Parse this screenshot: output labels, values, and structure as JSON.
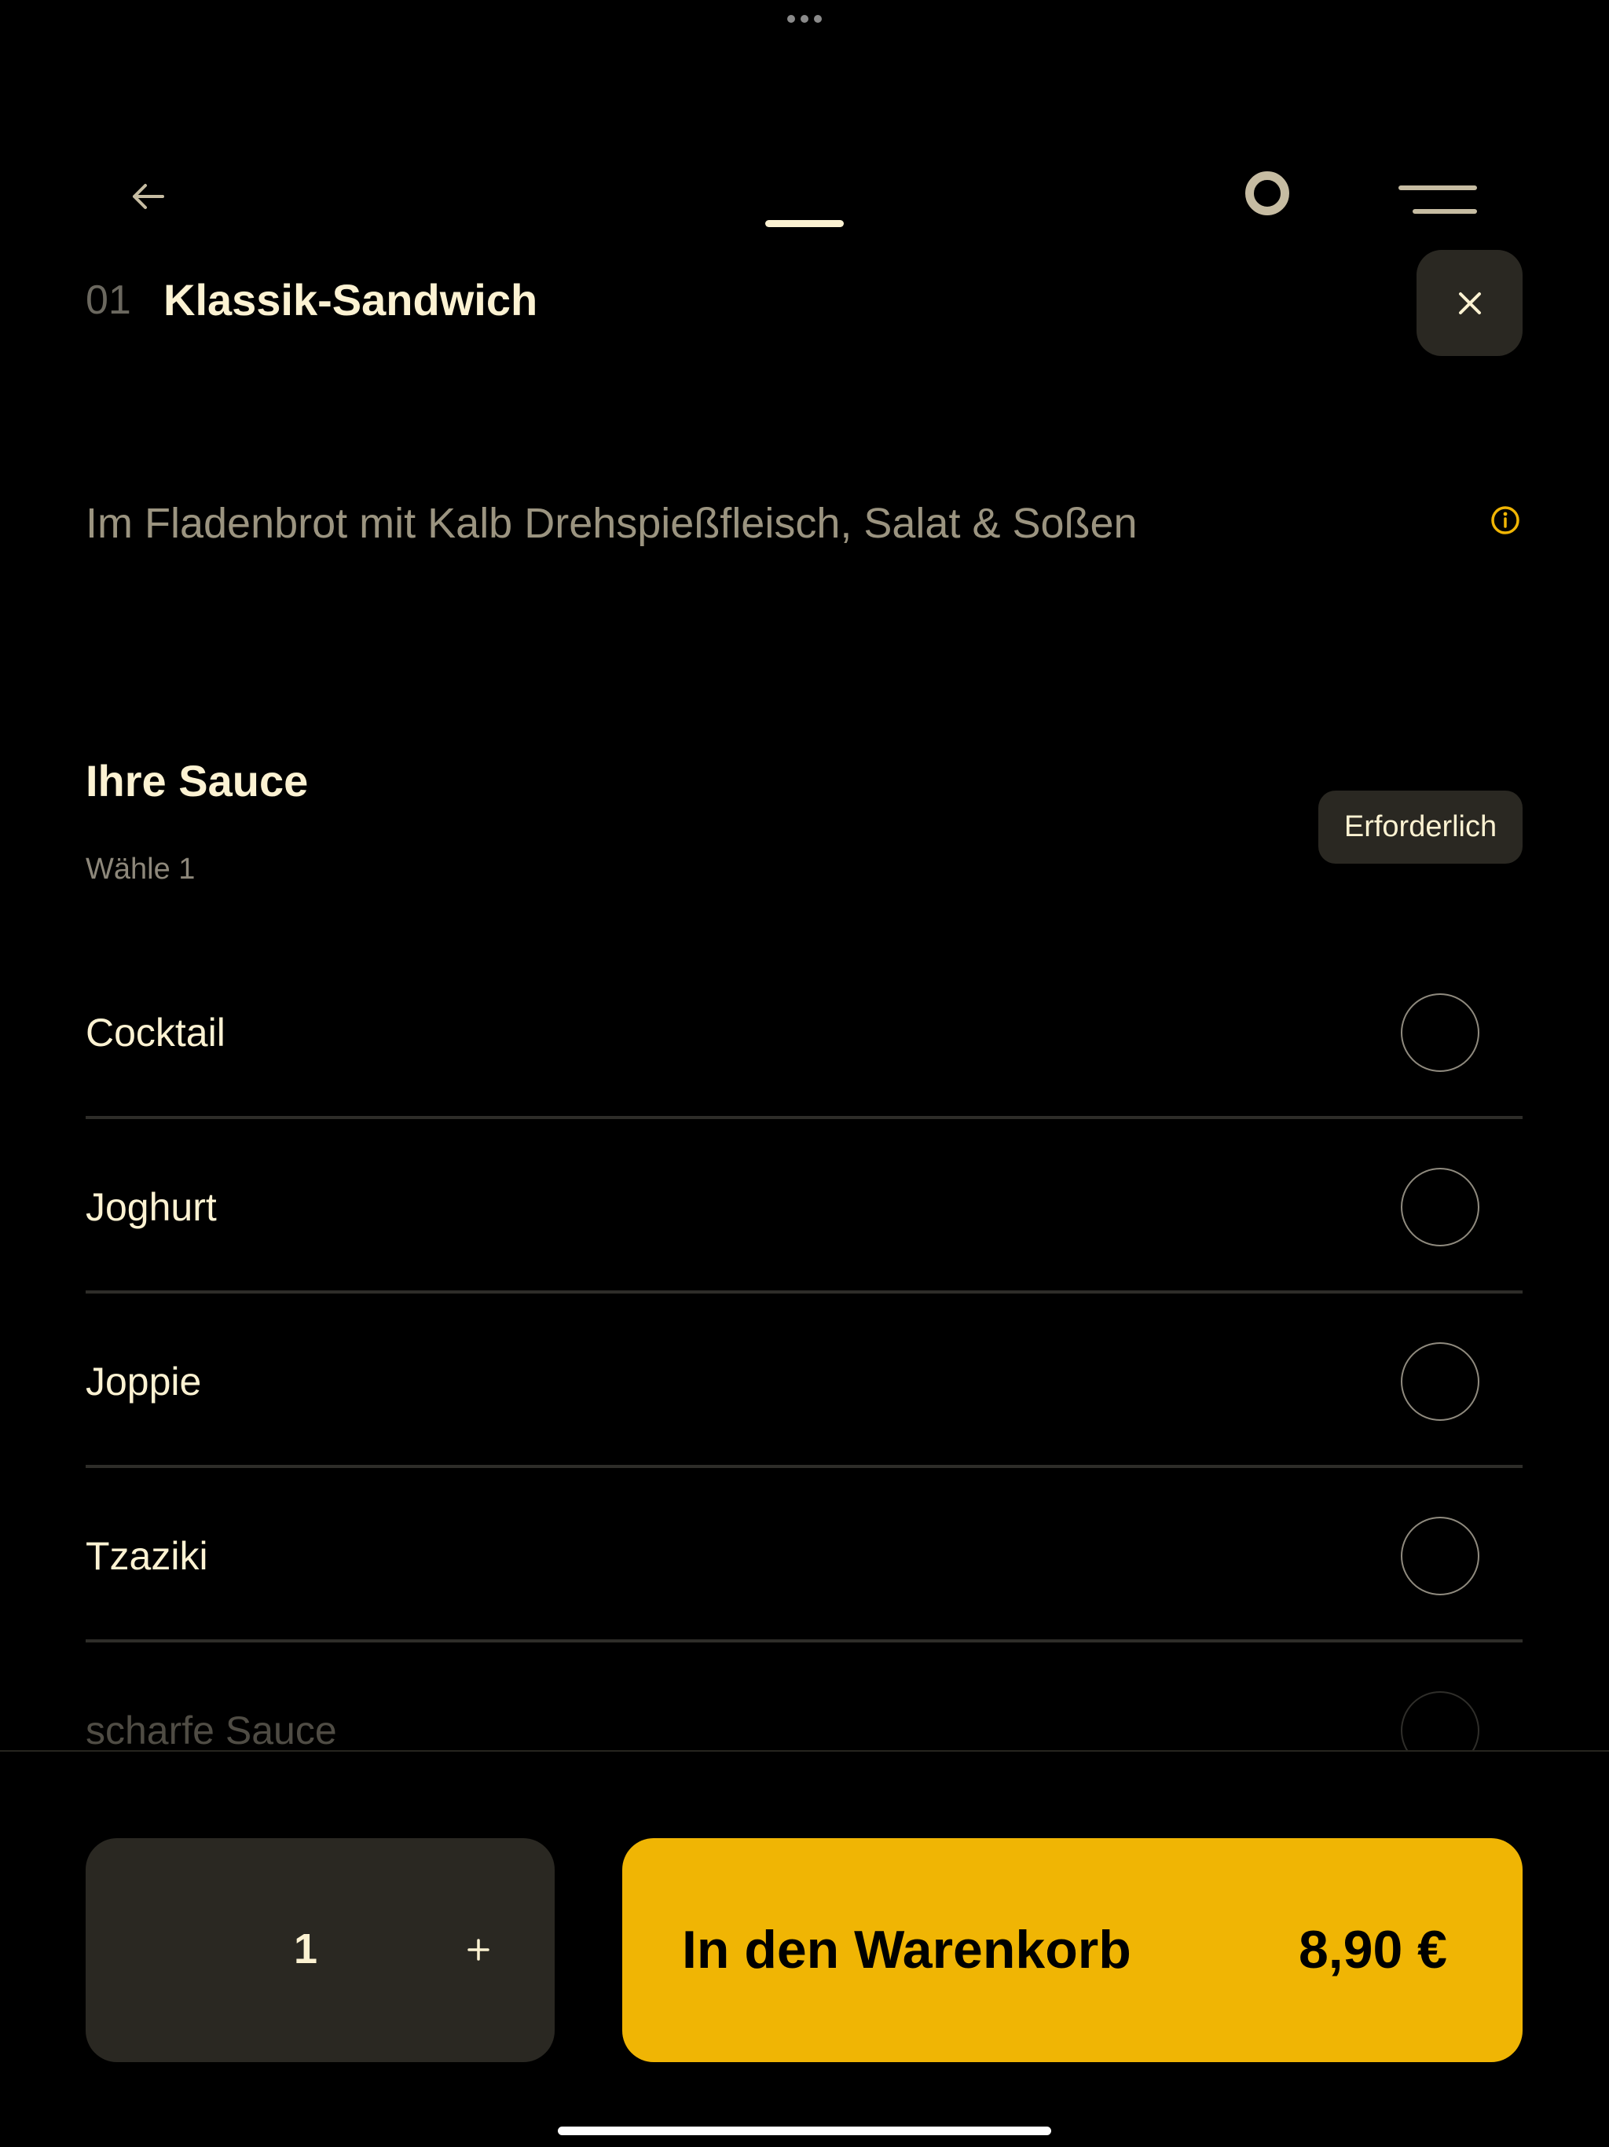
{
  "header": {
    "product_number": "01",
    "product_title": "Klassik-Sandwich"
  },
  "product": {
    "description": "Im Fladenbrot mit Kalb Drehspießfleisch, Salat & Soßen"
  },
  "sauce_section": {
    "title": "Ihre Sauce",
    "subtitle": "Wähle 1",
    "badge": "Erforderlich",
    "options": [
      {
        "label": "Cocktail"
      },
      {
        "label": "Joghurt"
      },
      {
        "label": "Joppie"
      },
      {
        "label": "Tzaziki"
      },
      {
        "label": "scharfe Sauce"
      }
    ]
  },
  "footer": {
    "quantity": "1",
    "add_to_cart_label": "In den Warenkorb",
    "price": "8,90 €"
  },
  "colors": {
    "accent": "#F0B504",
    "text_primary": "#FCF2D2",
    "surface": "#2a2822",
    "background": "#000000"
  },
  "icons": {
    "back": "arrow-left-icon",
    "status": "ring-icon",
    "menu": "menu-icon",
    "close": "close-icon",
    "info": "info-icon",
    "plus": "plus-icon"
  }
}
